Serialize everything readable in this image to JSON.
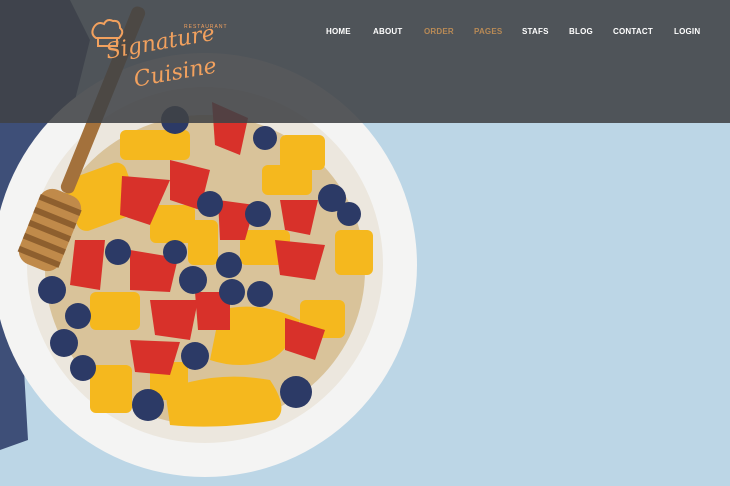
{
  "brand": {
    "name_line1": "Signature",
    "name_line2": "Cuisine",
    "tagline": "RESTAURANT",
    "accent_color": "#f2a15e"
  },
  "nav": {
    "items": [
      {
        "label": "HOME",
        "active": false
      },
      {
        "label": "ABOUT",
        "active": false
      },
      {
        "label": "ORDER",
        "active": true
      },
      {
        "label": "PAGES",
        "active": true
      },
      {
        "label": "STAFS",
        "active": false
      },
      {
        "label": "BLOG",
        "active": false
      },
      {
        "label": "CONTACT",
        "active": false
      },
      {
        "label": "LOGIN",
        "active": false
      }
    ],
    "active_color": "#b88a56"
  },
  "hero": {
    "image": "bowl-of-oatmeal-with-strawberries-mango-blueberries-icon",
    "background_color": "#bcd6e6"
  }
}
